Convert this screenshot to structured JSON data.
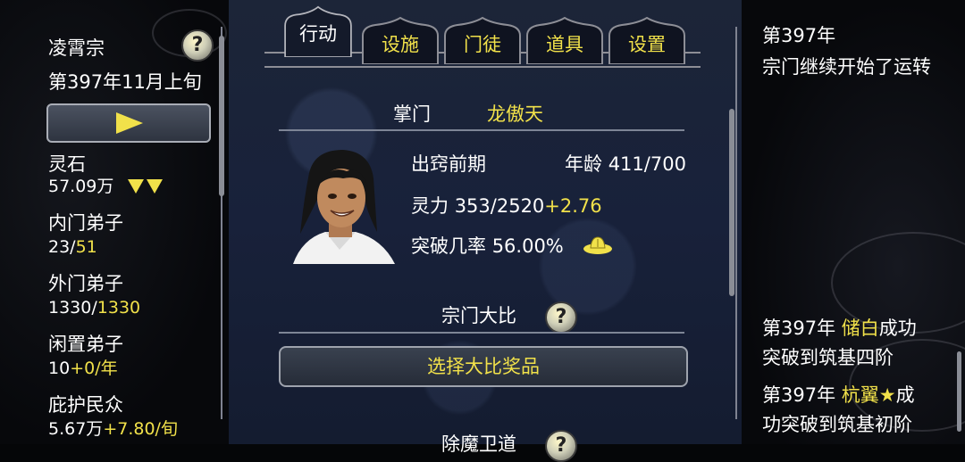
{
  "left": {
    "sect_name": "凌霄宗",
    "date": "第397年11月上旬",
    "stats": [
      {
        "label": "灵石",
        "value": "57.09万",
        "suffix": ""
      },
      {
        "label": "内门弟子",
        "value": "23/",
        "suffix": "51"
      },
      {
        "label": "外门弟子",
        "value": "1330/",
        "suffix": "1330"
      },
      {
        "label": "闲置弟子",
        "value": "10",
        "suffix": "+0/年"
      },
      {
        "label": "庇护民众",
        "value": "5.67万",
        "suffix": "+7.80/旬"
      }
    ]
  },
  "tabs": [
    "行动",
    "设施",
    "门徒",
    "道具",
    "设置"
  ],
  "active_tab": "行动",
  "leader": {
    "title_label": "掌门",
    "name": "龙傲天",
    "realm": "出窍前期",
    "age_label": "年龄",
    "age": "411/700",
    "power_label": "灵力",
    "power": "353/2520",
    "power_gain": "+2.76",
    "breakthrough_label": "突破几率",
    "breakthrough": "56.00%"
  },
  "tournament": {
    "title": "宗门大比",
    "select_button": "选择大比奖品",
    "next_title": "除魔卫道"
  },
  "log": {
    "top": {
      "year": "第397年",
      "text": "宗门继续开始了运转"
    },
    "entries": [
      {
        "year": "第397年",
        "name": "储白",
        "text_line1_tail": "成功",
        "text_line2": "突破到筑基四阶"
      },
      {
        "year": "第397年",
        "name": "杭翼★",
        "text_line1_tail": "成",
        "text_line2": "功突破到筑基初阶"
      }
    ]
  },
  "colors": {
    "accent": "#f1e14a",
    "panel_bg": "#18213a"
  }
}
